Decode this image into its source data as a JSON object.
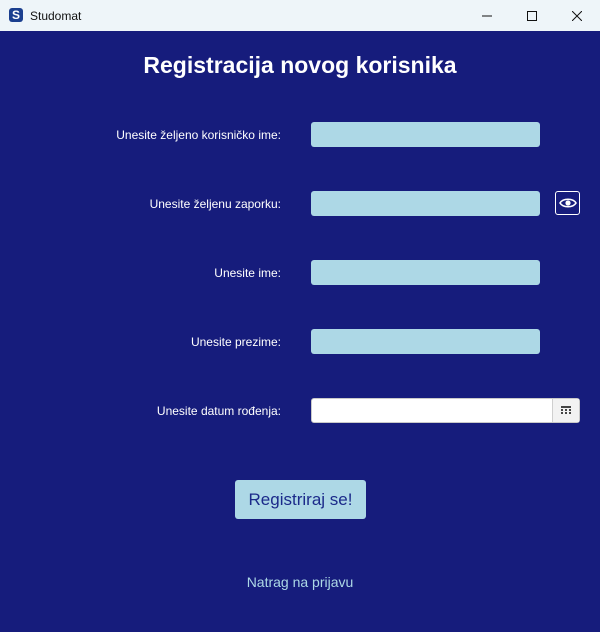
{
  "window": {
    "title": "Studomat",
    "app_icon_letter": "S",
    "icons": [
      "minimize-icon",
      "maximize-icon",
      "close-icon"
    ]
  },
  "page": {
    "heading": "Registracija novog korisnika"
  },
  "form": {
    "username_label": "Unesite željeno korisničko ime:",
    "username_value": "",
    "password_label": "Unesite željenu zaporku:",
    "password_value": "",
    "password_toggle_icon": "eye-icon",
    "first_name_label": "Unesite ime:",
    "first_name_value": "",
    "last_name_label": "Unesite prezime:",
    "last_name_value": "",
    "birth_date_label": "Unesite datum rođenja:",
    "birth_date_value": "",
    "calendar_icon": "calendar-icon",
    "submit_label": "Registriraj se!",
    "back_link": "Natrag na prijavu"
  },
  "colors": {
    "background": "#161c7c",
    "field": "#add8e6",
    "titlebar": "#eef5f9",
    "text": "#ffffff"
  }
}
